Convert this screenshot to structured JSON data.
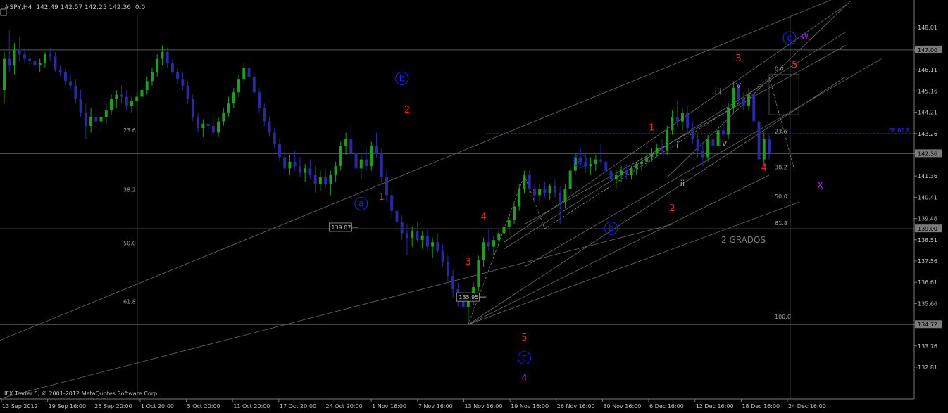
{
  "header": {
    "symbol": "#SPY,H4",
    "ohlc": "142.49 142.57 142.25 142.36",
    "indicator_value": "0.0"
  },
  "footer": {
    "copyright": "IFX Trader 5, © 2001-2012 MetaQuotes Software Corp."
  },
  "colors": {
    "background": "#000000",
    "bull_candle": "#1f9e1f",
    "bear_candle": "#2a2a9e",
    "grid": "#3a3a3a",
    "axis_text": "#c0c0c0",
    "wave_red": "#ff2020",
    "wave_blue": "#2020ff",
    "wave_purple": "#a020f0",
    "wave_gray": "#a0a0a0"
  },
  "chart_data": {
    "type": "candlestick",
    "symbol": "#SPY",
    "timeframe": "H4",
    "ylim": [
      132.4,
      148.6
    ],
    "price_ticks": [
      "148.01",
      "147.00",
      "146.11",
      "145.16",
      "144.21",
      "143.26",
      "142.36",
      "141.36",
      "140.41",
      "139.46",
      "139.00",
      "138.51",
      "137.56",
      "136.61",
      "135.66",
      "134.72",
      "133.76",
      "132.81"
    ],
    "highlighted_prices": [
      "147.00",
      "142.36",
      "139.00",
      "134.72"
    ],
    "x_labels": [
      "13 Sep 2012",
      "19 Sep 16:00",
      "25 Sep 20:00",
      "1 Oct 20:00",
      "5 Oct 20:00",
      "11 Oct 20:00",
      "17 Oct 20:00",
      "24 Oct 20:00",
      "1 Nov 16:00",
      "7 Nov 16:00",
      "13 Nov 16:00",
      "19 Nov 16:00",
      "26 Nov 16:00",
      "30 Nov 16:00",
      "6 Dec 16:00",
      "12 Dec 16:00",
      "18 Dec 16:00",
      "24 Dec 16:00"
    ],
    "price_boxes": [
      "139.07",
      "135.95"
    ],
    "horizontal_lines": [
      147.0,
      142.36,
      139.0,
      134.72
    ],
    "fibonacci_left": {
      "levels": [
        "23.6",
        "38.2",
        "50.0",
        "61.8"
      ],
      "prices": [
        143.26,
        140.6,
        138.2,
        135.6
      ]
    },
    "fibonacci_right": {
      "levels": [
        "0.0",
        "23.6",
        "38.2",
        "50.0",
        "61.8",
        "100.0"
      ],
      "prices": [
        146.0,
        143.2,
        141.6,
        140.3,
        139.1,
        134.92
      ]
    },
    "fe_label": "FE 61.8",
    "fe_price": 143.26,
    "wave_labels_red": [
      "1",
      "2",
      "3",
      "4",
      "5",
      "1",
      "2",
      "3",
      "4",
      "5"
    ],
    "wave_labels_blue": [
      "a",
      "b",
      "c",
      "a",
      "b",
      "c"
    ],
    "wave_labels_purple": [
      "4",
      "w",
      "X"
    ],
    "wave_labels_gray": [
      "i",
      "ii",
      "iii",
      "iv",
      "v"
    ],
    "annotation": "2 GRADOS",
    "candles": [
      [
        145.2,
        146.9,
        144.6,
        146.6
      ],
      [
        146.6,
        147.9,
        146.0,
        146.3
      ],
      [
        146.3,
        147.3,
        145.9,
        147.0
      ],
      [
        147.0,
        147.6,
        146.5,
        146.8
      ],
      [
        146.8,
        147.1,
        146.4,
        146.6
      ],
      [
        146.6,
        146.9,
        146.3,
        146.5
      ],
      [
        146.5,
        146.7,
        146.0,
        146.3
      ],
      [
        146.3,
        146.6,
        146.0,
        146.4
      ],
      [
        146.4,
        146.9,
        146.2,
        146.8
      ],
      [
        146.8,
        147.1,
        146.5,
        146.7
      ],
      [
        146.7,
        146.9,
        146.0,
        146.1
      ],
      [
        146.1,
        146.3,
        145.8,
        146.0
      ],
      [
        146.0,
        146.2,
        145.4,
        145.6
      ],
      [
        145.6,
        145.9,
        145.2,
        145.4
      ],
      [
        145.4,
        145.7,
        144.6,
        144.8
      ],
      [
        144.8,
        145.2,
        144.0,
        144.2
      ],
      [
        144.2,
        144.6,
        143.0,
        143.6
      ],
      [
        143.6,
        144.4,
        143.3,
        144.0
      ],
      [
        144.0,
        144.3,
        143.5,
        143.8
      ],
      [
        143.8,
        144.2,
        143.4,
        144.0
      ],
      [
        144.0,
        144.6,
        143.7,
        144.3
      ],
      [
        144.3,
        145.0,
        144.1,
        144.8
      ],
      [
        144.8,
        145.2,
        144.4,
        145.0
      ],
      [
        145.0,
        145.4,
        144.6,
        144.9
      ],
      [
        144.9,
        145.2,
        144.3,
        144.5
      ],
      [
        144.5,
        144.9,
        144.2,
        144.7
      ],
      [
        144.7,
        145.1,
        144.5,
        144.9
      ],
      [
        144.9,
        145.4,
        144.7,
        145.2
      ],
      [
        145.2,
        145.8,
        145.0,
        145.6
      ],
      [
        145.6,
        146.2,
        145.4,
        146.0
      ],
      [
        146.0,
        146.8,
        145.8,
        146.6
      ],
      [
        146.6,
        147.2,
        146.3,
        146.9
      ],
      [
        146.9,
        147.1,
        146.2,
        146.4
      ],
      [
        146.4,
        146.6,
        145.9,
        146.0
      ],
      [
        146.0,
        146.2,
        145.5,
        145.7
      ],
      [
        145.7,
        146.0,
        145.2,
        145.4
      ],
      [
        145.4,
        145.6,
        144.6,
        144.8
      ],
      [
        144.8,
        145.0,
        143.8,
        144.0
      ],
      [
        144.0,
        144.2,
        143.3,
        143.5
      ],
      [
        143.5,
        143.9,
        143.1,
        143.7
      ],
      [
        143.7,
        144.1,
        143.4,
        143.6
      ],
      [
        143.6,
        144.0,
        143.2,
        143.3
      ],
      [
        143.3,
        144.0,
        143.1,
        143.8
      ],
      [
        143.8,
        144.4,
        143.6,
        144.2
      ],
      [
        144.2,
        144.9,
        144.0,
        144.6
      ],
      [
        144.6,
        145.3,
        144.4,
        145.1
      ],
      [
        145.1,
        145.9,
        144.9,
        145.7
      ],
      [
        145.7,
        146.4,
        145.5,
        146.2
      ],
      [
        146.2,
        146.6,
        145.6,
        145.8
      ],
      [
        145.8,
        146.0,
        144.9,
        145.1
      ],
      [
        145.1,
        145.3,
        144.2,
        144.4
      ],
      [
        144.4,
        144.6,
        143.6,
        143.8
      ],
      [
        143.8,
        144.0,
        143.1,
        143.3
      ],
      [
        143.3,
        143.5,
        142.6,
        142.8
      ],
      [
        142.8,
        143.0,
        142.0,
        142.2
      ],
      [
        142.2,
        142.5,
        141.5,
        141.7
      ],
      [
        141.7,
        142.3,
        141.4,
        142.0
      ],
      [
        142.0,
        142.5,
        141.6,
        141.8
      ],
      [
        141.8,
        142.2,
        141.3,
        141.5
      ],
      [
        141.5,
        141.9,
        141.1,
        141.7
      ],
      [
        141.7,
        142.1,
        141.2,
        141.4
      ],
      [
        141.4,
        141.8,
        140.6,
        141.0
      ],
      [
        141.0,
        141.6,
        140.7,
        141.3
      ],
      [
        141.3,
        141.7,
        140.8,
        141.0
      ],
      [
        141.0,
        141.6,
        140.5,
        141.4
      ],
      [
        141.4,
        142.0,
        141.1,
        141.8
      ],
      [
        141.8,
        142.9,
        141.6,
        142.7
      ],
      [
        142.7,
        143.3,
        142.3,
        143.0
      ],
      [
        143.0,
        143.6,
        142.2,
        142.4
      ],
      [
        142.4,
        142.8,
        141.5,
        141.7
      ],
      [
        141.7,
        142.3,
        141.2,
        142.1
      ],
      [
        142.1,
        142.6,
        141.6,
        141.8
      ],
      [
        141.8,
        142.9,
        141.6,
        142.7
      ],
      [
        142.7,
        143.3,
        142.2,
        142.4
      ],
      [
        142.4,
        142.6,
        141.0,
        141.3
      ],
      [
        141.3,
        141.6,
        140.2,
        140.5
      ],
      [
        140.5,
        140.8,
        139.5,
        139.8
      ],
      [
        139.8,
        140.0,
        139.0,
        139.3
      ],
      [
        139.3,
        139.6,
        138.5,
        138.8
      ],
      [
        138.8,
        139.2,
        137.8,
        138.6
      ],
      [
        138.6,
        139.1,
        138.2,
        138.9
      ],
      [
        138.9,
        139.3,
        138.4,
        138.5
      ],
      [
        138.5,
        138.9,
        138.1,
        138.7
      ],
      [
        138.7,
        139.0,
        138.0,
        138.2
      ],
      [
        138.2,
        138.6,
        137.7,
        138.4
      ],
      [
        138.4,
        138.8,
        137.9,
        138.0
      ],
      [
        138.0,
        138.3,
        137.3,
        137.5
      ],
      [
        137.5,
        137.8,
        136.6,
        136.9
      ],
      [
        136.9,
        137.2,
        135.9,
        136.3
      ],
      [
        136.3,
        136.6,
        135.5,
        135.8
      ],
      [
        135.8,
        136.2,
        135.2,
        135.5
      ],
      [
        135.5,
        136.0,
        134.8,
        135.9
      ],
      [
        135.9,
        136.6,
        135.6,
        136.4
      ],
      [
        136.4,
        137.8,
        136.2,
        137.6
      ],
      [
        137.6,
        138.6,
        137.3,
        138.4
      ],
      [
        138.4,
        139.0,
        138.0,
        138.2
      ],
      [
        138.2,
        138.7,
        137.8,
        138.5
      ],
      [
        138.5,
        139.0,
        138.2,
        138.8
      ],
      [
        138.8,
        139.3,
        138.5,
        139.1
      ],
      [
        139.1,
        139.6,
        138.8,
        139.4
      ],
      [
        139.4,
        140.2,
        139.2,
        140.0
      ],
      [
        140.0,
        141.0,
        139.8,
        140.8
      ],
      [
        140.8,
        141.6,
        140.6,
        141.4
      ],
      [
        141.4,
        141.6,
        140.6,
        140.8
      ],
      [
        140.8,
        141.0,
        140.2,
        140.5
      ],
      [
        140.5,
        141.0,
        140.2,
        140.8
      ],
      [
        140.8,
        141.1,
        140.4,
        140.6
      ],
      [
        140.6,
        141.0,
        140.3,
        140.9
      ],
      [
        140.9,
        141.2,
        140.4,
        140.6
      ],
      [
        140.6,
        140.9,
        139.2,
        140.2
      ],
      [
        140.2,
        141.0,
        139.9,
        140.8
      ],
      [
        140.8,
        141.8,
        140.6,
        141.6
      ],
      [
        141.6,
        142.4,
        141.4,
        142.2
      ],
      [
        142.2,
        142.6,
        141.8,
        142.0
      ],
      [
        142.0,
        142.3,
        141.5,
        141.8
      ],
      [
        141.8,
        142.2,
        141.4,
        141.9
      ],
      [
        141.9,
        142.3,
        141.6,
        142.1
      ],
      [
        142.1,
        142.8,
        141.8,
        142.0
      ],
      [
        142.0,
        142.3,
        141.4,
        141.6
      ],
      [
        141.6,
        141.9,
        141.0,
        141.2
      ],
      [
        141.2,
        141.6,
        140.8,
        141.4
      ],
      [
        141.4,
        141.8,
        141.1,
        141.6
      ],
      [
        141.6,
        141.9,
        141.2,
        141.4
      ],
      [
        141.4,
        141.8,
        141.2,
        141.7
      ],
      [
        141.7,
        142.0,
        141.4,
        141.9
      ],
      [
        141.9,
        142.2,
        141.6,
        142.0
      ],
      [
        142.0,
        142.4,
        141.8,
        142.2
      ],
      [
        142.2,
        142.6,
        142.0,
        142.4
      ],
      [
        142.4,
        142.8,
        142.2,
        142.6
      ],
      [
        142.6,
        143.0,
        142.3,
        142.5
      ],
      [
        142.5,
        143.6,
        142.3,
        143.4
      ],
      [
        143.4,
        144.3,
        143.2,
        144.0
      ],
      [
        144.0,
        144.7,
        143.6,
        143.8
      ],
      [
        143.8,
        144.4,
        143.4,
        144.2
      ],
      [
        144.2,
        144.5,
        143.3,
        143.5
      ],
      [
        143.5,
        143.8,
        142.8,
        143.0
      ],
      [
        143.0,
        143.3,
        142.2,
        142.5
      ],
      [
        142.5,
        142.8,
        141.8,
        142.2
      ],
      [
        142.2,
        143.2,
        142.0,
        143.0
      ],
      [
        143.0,
        143.4,
        142.5,
        142.7
      ],
      [
        142.7,
        143.6,
        142.5,
        143.4
      ],
      [
        143.4,
        143.8,
        143.0,
        143.2
      ],
      [
        143.2,
        144.6,
        143.0,
        144.4
      ],
      [
        144.4,
        145.6,
        144.2,
        145.3
      ],
      [
        145.3,
        145.5,
        144.6,
        144.8
      ],
      [
        144.8,
        145.1,
        144.3,
        144.5
      ],
      [
        144.5,
        145.3,
        144.3,
        145.0
      ],
      [
        145.0,
        145.2,
        143.5,
        143.8
      ],
      [
        143.8,
        144.1,
        141.6,
        142.1
      ],
      [
        142.1,
        143.3,
        141.8,
        143.0
      ],
      [
        143.0,
        143.2,
        142.1,
        142.4
      ]
    ]
  }
}
